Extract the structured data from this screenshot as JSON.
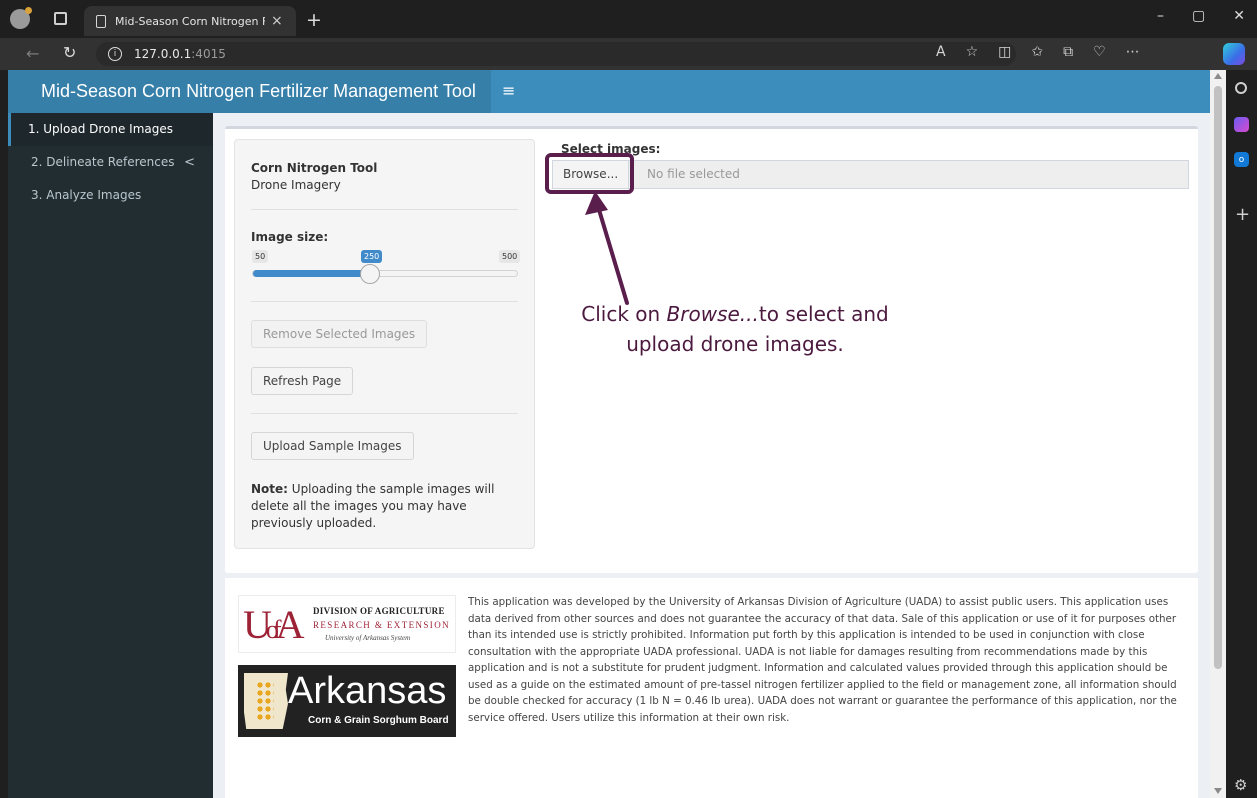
{
  "browser": {
    "tab_title": "Mid-Season Corn Nitrogen Fertili",
    "tab_close": "×",
    "new_tab": "+",
    "url_host": "127.0.0.1",
    "url_port": ":4015",
    "window_controls": [
      "–",
      "▢",
      "✕"
    ],
    "toolbar_icons": [
      "read-aloud-icon",
      "favorite-star-icon",
      "split-screen-icon",
      "favorites-icon",
      "collections-icon",
      "browser-essentials-icon",
      "more-icon"
    ]
  },
  "app": {
    "title": "Mid-Season Corn Nitrogen Fertilizer Management Tool",
    "menu_icon": "≡"
  },
  "sidebar": {
    "items": [
      {
        "label": "1. Upload Drone Images",
        "active": true
      },
      {
        "label": "2. Delineate References",
        "active": false,
        "chevron": "<"
      },
      {
        "label": "3. Analyze Images",
        "active": false
      }
    ]
  },
  "panel": {
    "title": "Corn Nitrogen Tool",
    "subtitle": "Drone Imagery",
    "slider": {
      "label": "Image size:",
      "min_label": "50",
      "max_label": "500",
      "value_label": "250",
      "min": 50,
      "max": 500,
      "value": 250
    },
    "remove_button": "Remove Selected Images",
    "refresh_button": "Refresh Page",
    "sample_button": "Upload Sample Images",
    "note_bold": "Note:",
    "note_text": " Uploading the sample images will delete all the images you may have previously uploaded."
  },
  "upload": {
    "label": "Select images:",
    "browse_button": "Browse...",
    "placeholder": "No file selected"
  },
  "annotation": {
    "prefix": "Click on ",
    "emphasis": "Browse...",
    "suffix": "to select and upload drone images.",
    "color": "#5a1e4d"
  },
  "footer": {
    "uada_logo": {
      "mark": "UofA",
      "line1": "DIVISION OF AGRICULTURE",
      "line2": "RESEARCH & EXTENSION",
      "line3": "University of Arkansas System"
    },
    "arkansas_logo": {
      "title": "Arkansas",
      "subtitle": "Corn & Grain Sorghum Board"
    },
    "disclaimer": "This application was developed by the University of Arkansas Division of Agriculture (UADA) to assist public users. This application uses data derived from other sources and does not guarantee the accuracy of that data. Sale of this application or use of it for purposes other than its intended use is strictly prohibited. Information put forth by this application is intended to be used in conjunction with close consultation with the appropriate UADA professional. UADA is not liable for damages resulting from recommendations made by this application and is not a substitute for prudent judgment. Information and calculated values provided through this application should be used as a guide on the estimated amount of pre-tassel nitrogen fertilizer applied to the field or management zone, all information should be double checked for accuracy (1 lb N = 0.46 lb urea). UADA does not warrant or guarantee the performance of this application, nor the service offered. Users utilize this information at their own risk."
  },
  "colors": {
    "header": "#3c8dbc",
    "logo_bg": "#367fa9",
    "sidebar_bg": "#222d32",
    "slider_accent": "#428bca",
    "annotation": "#5a1e4d"
  }
}
